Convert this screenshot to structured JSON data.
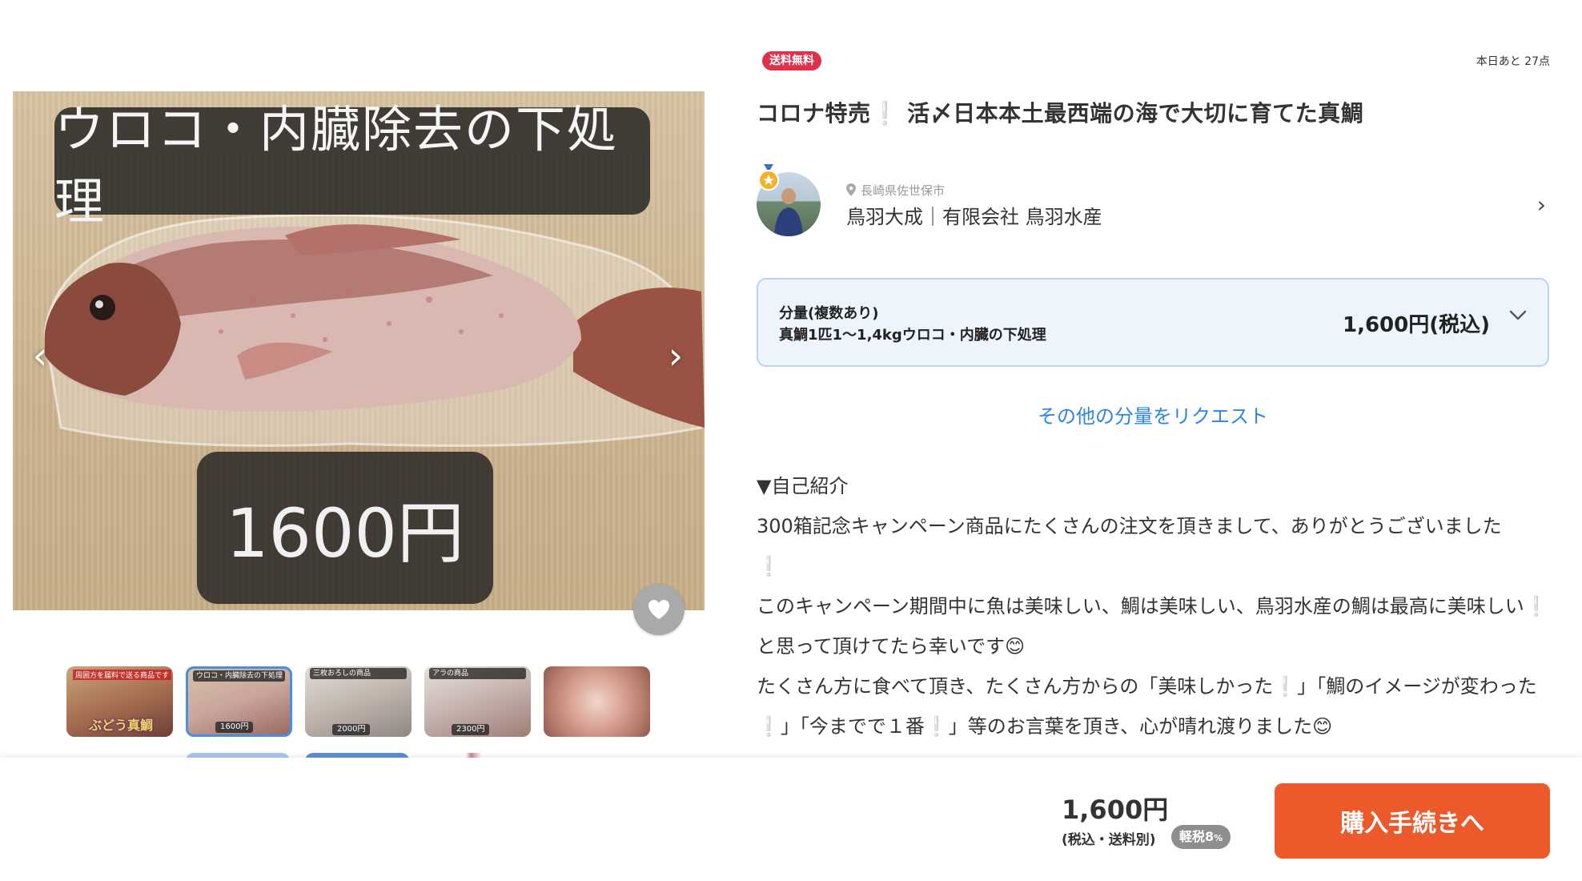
{
  "gallery": {
    "caption": "ウロコ・内臓除去の下処理",
    "price_overlay": "1600円",
    "prev_icon": "‹",
    "next_icon": "›",
    "favorite_icon": "heart-icon",
    "thumbnails": [
      {
        "top_label": "周囲方を届料で送る商品です",
        "brand": "ぶどう真鯛"
      },
      {
        "top_label": "ウロコ・内臓除去の下処理",
        "price": "1600円"
      },
      {
        "top_label": "三枚おろしの商品",
        "price": "2000円"
      },
      {
        "top_label": "アラの商品",
        "price": "2300円"
      },
      {}
    ]
  },
  "product": {
    "free_shipping_badge": "送料無料",
    "stock_note": "本日あと 27点",
    "title_part1": "コロナ特売",
    "title_excl": "❕",
    "title_part2": " 活〆日本本土最西端の海で大切に育てた真鯛"
  },
  "seller": {
    "location": "長崎県佐世保市",
    "name": "鳥羽大成｜有限会社 鳥羽水産",
    "chevron": "›"
  },
  "variant": {
    "label": "分量(複数あり)",
    "value": "真鯛1匹1〜1,4kgウロコ・内臓の下処理",
    "price": "1,600円(税込)"
  },
  "request_link": "その他の分量をリクエスト",
  "description": {
    "heading": "▼自己紹介",
    "p1": "300箱記念キャンペーン商品にたくさんの注文を頂きまして、ありがとうございました",
    "p1_excl": "❕",
    "p2a": "このキャンペーン期間中に魚は美味しい、鯛は美味しい、鳥羽水産の鯛は最高に美味しい",
    "p2_excl": "❕",
    "p2b": " と思って頂けてたら幸いです😊",
    "p3a": "たくさん方に食べて頂き、たくさん方からの「美味しかった",
    "p3_excl1": "❕",
    "p3b": "」「鯛のイメージが変わった",
    "p3_excl2": "❕",
    "p3c": "」「今までで１番",
    "p3_excl3": "❕",
    "p3d": "」等のお言葉を頂き、心が晴れ渡りました😊"
  },
  "bottom_bar": {
    "price": "1,600円",
    "tax_note": "(税込・送料別)",
    "tax_badge": "軽税",
    "tax_badge_rate": "8",
    "tax_badge_unit": "%",
    "buy_button": "購入手続きへ"
  },
  "colors": {
    "accent_blue": "#2f86e0",
    "badge_red": "#e0304b",
    "buy_orange": "#ec5a2b"
  }
}
